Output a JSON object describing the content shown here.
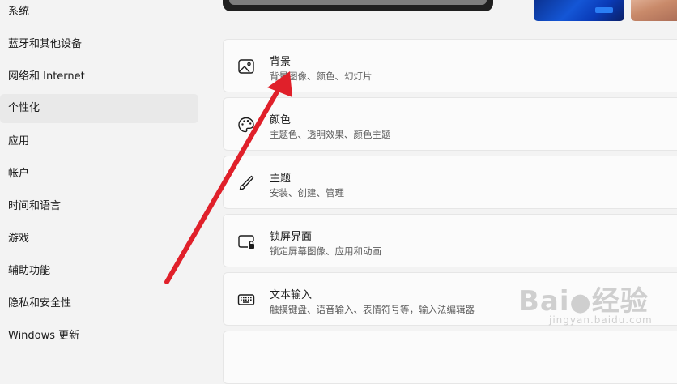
{
  "sidebar": {
    "items": [
      {
        "label": "系统"
      },
      {
        "label": "蓝牙和其他设备"
      },
      {
        "label": "网络和 Internet"
      },
      {
        "label": "个性化"
      },
      {
        "label": "应用"
      },
      {
        "label": "帐户"
      },
      {
        "label": "时间和语言"
      },
      {
        "label": "游戏"
      },
      {
        "label": "辅助功能"
      },
      {
        "label": "隐私和安全性"
      },
      {
        "label": "Windows 更新"
      }
    ],
    "selected": "个性化"
  },
  "cards": [
    {
      "title": "背景",
      "desc": "背景图像、颜色、幻灯片",
      "icon": "image-icon"
    },
    {
      "title": "颜色",
      "desc": "主题色、透明效果、颜色主题",
      "icon": "palette-icon"
    },
    {
      "title": "主题",
      "desc": "安装、创建、管理",
      "icon": "brush-icon"
    },
    {
      "title": "锁屏界面",
      "desc": "锁定屏幕图像、应用和动画",
      "icon": "lock-screen-icon"
    },
    {
      "title": "文本输入",
      "desc": "触摸键盘、语音输入、表情符号等，输入法编辑器",
      "icon": "keyboard-icon"
    }
  ],
  "watermark": {
    "brand": "Bai",
    "brand2": "经验",
    "url": "jingyan.baidu.com"
  },
  "annotation": {
    "color": "#e0202a"
  }
}
